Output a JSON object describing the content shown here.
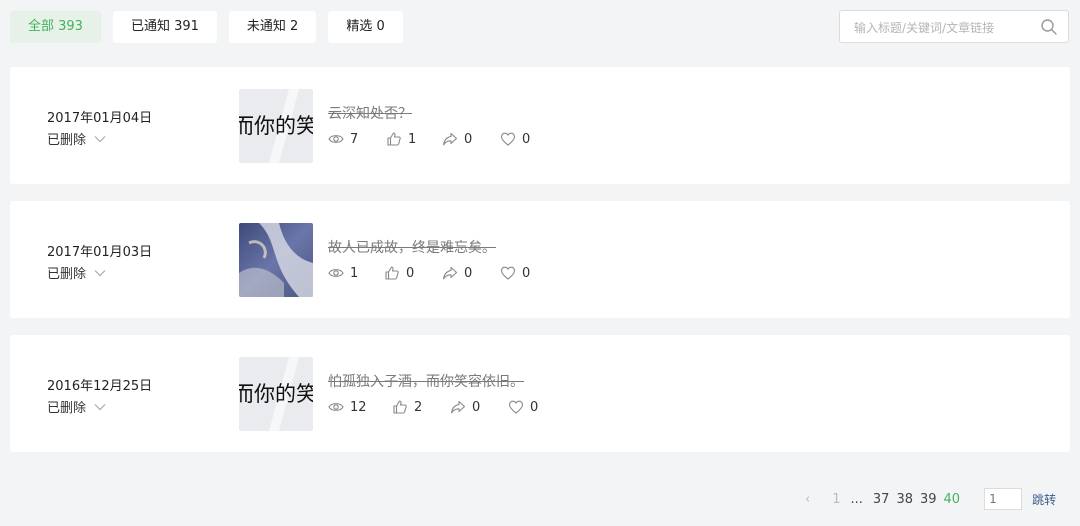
{
  "tabs": [
    {
      "label": "全部 393",
      "active": true
    },
    {
      "label": "已通知 391",
      "active": false
    },
    {
      "label": "未通知 2",
      "active": false
    },
    {
      "label": "精选 0",
      "active": false
    }
  ],
  "search": {
    "placeholder": "输入标题/关键词/文章链接",
    "icon": "search-icon"
  },
  "articles": [
    {
      "date": "2017年01月04日",
      "status": "已删除",
      "title": "云深知处否？",
      "views": "7",
      "likes": "1",
      "shares": "0",
      "favorites": "0",
      "thumb_text": "而你的笑"
    },
    {
      "date": "2017年01月03日",
      "status": "已删除",
      "title": "故人已成故，终是难忘矣。",
      "views": "1",
      "likes": "0",
      "shares": "0",
      "favorites": "0"
    },
    {
      "date": "2016年12月25日",
      "status": "已删除",
      "title": "怕孤独入子酒，而你笑容依旧。",
      "views": "12",
      "likes": "2",
      "shares": "0",
      "favorites": "0",
      "thumb_text": "而你的笑"
    }
  ],
  "pagination": {
    "prev": "‹",
    "first": "1",
    "ellipsis": "...",
    "pages": [
      "37",
      "38",
      "39"
    ],
    "current": "40",
    "jump_placeholder": "1",
    "jump_label": "跳转"
  },
  "colors": {
    "accent": "#44b25a",
    "tab_active_bg": "#e6f1e8",
    "background": "#f3f4f6"
  }
}
